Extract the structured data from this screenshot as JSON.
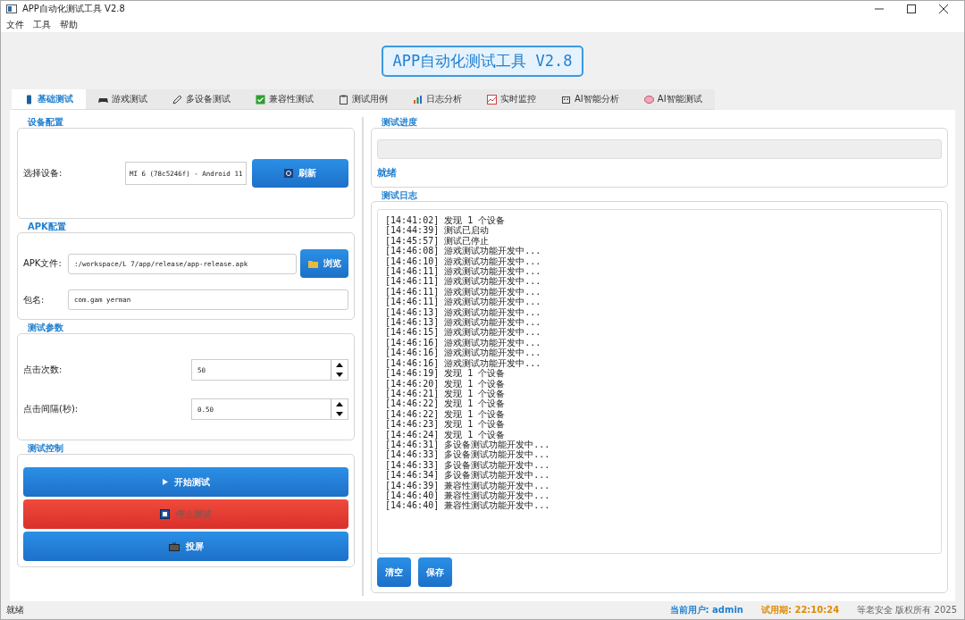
{
  "window": {
    "title": "APP自动化测试工具 V2.8"
  },
  "menu": [
    "文件",
    "工具",
    "帮助"
  ],
  "app_title": "APP自动化测试工具 V2.8",
  "tabs": [
    {
      "label": "基础测试",
      "selected": true
    },
    {
      "label": "游戏测试",
      "selected": false
    },
    {
      "label": "多设备测试",
      "selected": false
    },
    {
      "label": "兼容性测试",
      "selected": false
    },
    {
      "label": "测试用例",
      "selected": false
    },
    {
      "label": "日志分析",
      "selected": false
    },
    {
      "label": "实时监控",
      "selected": false
    },
    {
      "label": "AI智能分析",
      "selected": false
    },
    {
      "label": "AI智能测试",
      "selected": false
    }
  ],
  "device_config": {
    "title": "设备配置",
    "label": "选择设备:",
    "value": "MI 6 (78c5246f) - Android 11",
    "refresh_button": "刷新"
  },
  "apk_config": {
    "title": "APK配置",
    "file_label": "APK文件:",
    "file_value": ":/workspace/L           7/app/release/app-release.apk",
    "browse_button": "浏览",
    "package_label": "包名:",
    "package_value": "com.gam     yerman"
  },
  "test_params": {
    "title": "测试参数",
    "fields": [
      {
        "label": "点击次数:",
        "value": "50"
      },
      {
        "label": "点击间隔(秒):",
        "value": "0.50"
      }
    ]
  },
  "test_control": {
    "title": "测试控制",
    "buttons": [
      {
        "label": "开始测试",
        "kind": "start",
        "disabled": false
      },
      {
        "label": "停止测试",
        "kind": "stop",
        "disabled": true
      },
      {
        "label": "投屏",
        "kind": "screen",
        "disabled": false
      }
    ]
  },
  "progress": {
    "title": "测试进度",
    "level": 0,
    "status": "就绪"
  },
  "log": {
    "title": "测试日志",
    "lines": [
      "[14:41:02] 发现 1 个设备",
      "[14:44:39] 测试已启动",
      "[14:45:57] 测试已停止",
      "[14:46:08] 游戏测试功能开发中...",
      "[14:46:10] 游戏测试功能开发中...",
      "[14:46:11] 游戏测试功能开发中...",
      "[14:46:11] 游戏测试功能开发中...",
      "[14:46:11] 游戏测试功能开发中...",
      "[14:46:11] 游戏测试功能开发中...",
      "[14:46:13] 游戏测试功能开发中...",
      "[14:46:13] 游戏测试功能开发中...",
      "[14:46:15] 游戏测试功能开发中...",
      "[14:46:16] 游戏测试功能开发中...",
      "[14:46:16] 游戏测试功能开发中...",
      "[14:46:16] 游戏测试功能开发中...",
      "[14:46:19] 发现 1 个设备",
      "[14:46:20] 发现 1 个设备",
      "[14:46:21] 发现 1 个设备",
      "[14:46:22] 发现 1 个设备",
      "[14:46:22] 发现 1 个设备",
      "[14:46:23] 发现 1 个设备",
      "[14:46:24] 发现 1 个设备",
      "[14:46:31] 多设备测试功能开发中...",
      "[14:46:33] 多设备测试功能开发中...",
      "[14:46:33] 多设备测试功能开发中...",
      "[14:46:34] 多设备测试功能开发中...",
      "[14:46:39] 兼容性测试功能开发中...",
      "[14:46:40] 兼容性测试功能开发中...",
      "[14:46:40] 兼容性测试功能开发中..."
    ],
    "buttons": [
      "清空",
      "保存"
    ]
  },
  "status_bar": {
    "message": "就绪",
    "user_label": "当前用户:",
    "user": "admin",
    "trial_label": "试用期:",
    "trial": "22:10:24",
    "copyright": "等老安全 版权所有 2025"
  }
}
